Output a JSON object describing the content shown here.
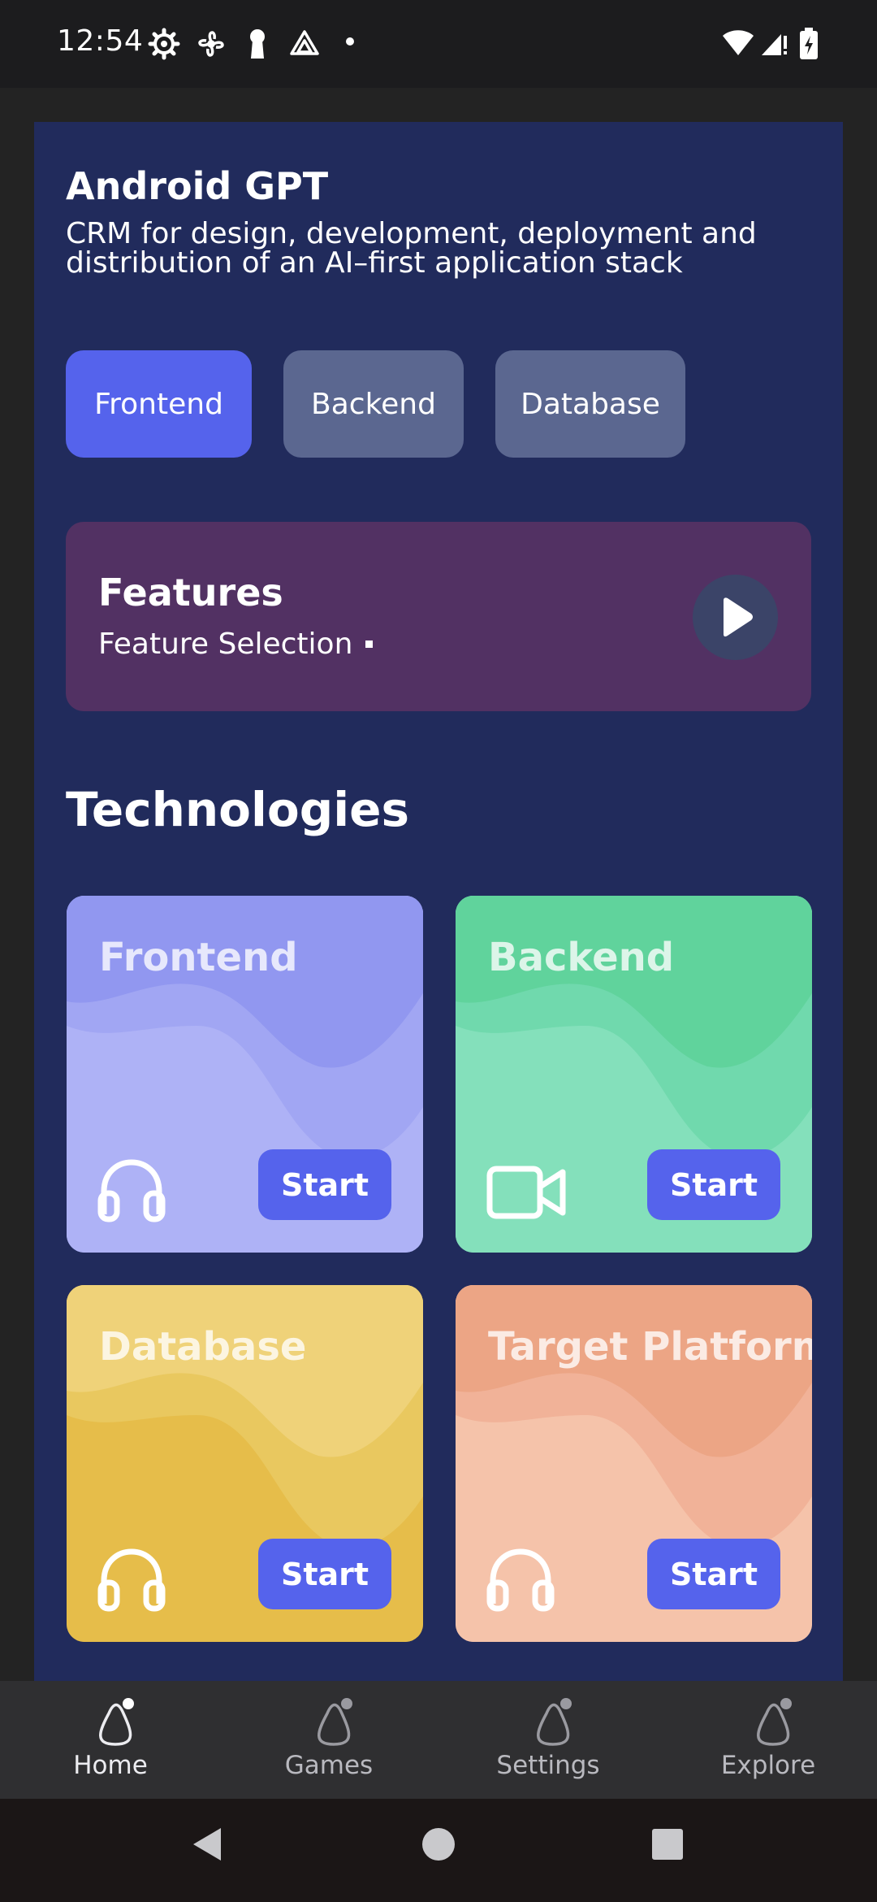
{
  "status_bar": {
    "time": "12:54",
    "left_icons": [
      "gear-icon",
      "fan-icon",
      "keyhole-icon",
      "drive-icon",
      "dot-icon"
    ],
    "right_icons": [
      "wifi-icon",
      "cell-signal-icon",
      "battery-charging-icon"
    ]
  },
  "app": {
    "title": "Android GPT",
    "subtitle": "CRM for design, development, deployment and distribution of an AI–first application stack"
  },
  "tabs": [
    {
      "label": "Frontend",
      "active": true
    },
    {
      "label": "Backend",
      "active": false
    },
    {
      "label": "Database",
      "active": false
    }
  ],
  "features": {
    "title": "Features",
    "subtitle": "Feature Selection",
    "action_icon": "play-icon"
  },
  "technologies": {
    "section_title": "Technologies",
    "start_label": "Start",
    "cards": [
      {
        "name": "Frontend",
        "icon": "headphones-icon",
        "color": "#9aa2f3"
      },
      {
        "name": "Backend",
        "icon": "video-camera-icon",
        "color": "#6dd7a8"
      },
      {
        "name": "Database",
        "icon": "headphones-icon",
        "color": "#ecc65c"
      },
      {
        "name": "Target Platform",
        "icon": "headphones-icon",
        "color": "#f0ae8e"
      }
    ]
  },
  "bottom_nav": {
    "items": [
      {
        "label": "Home",
        "active": true
      },
      {
        "label": "Games",
        "active": false
      },
      {
        "label": "Settings",
        "active": false
      },
      {
        "label": "Explore",
        "active": false
      }
    ]
  },
  "system_nav": [
    "back-icon",
    "home-icon",
    "recents-icon"
  ],
  "colors": {
    "panel": "#212b5c",
    "accent": "#5563ec",
    "chip_inactive": "#5b6790",
    "features_card": "#523163"
  }
}
